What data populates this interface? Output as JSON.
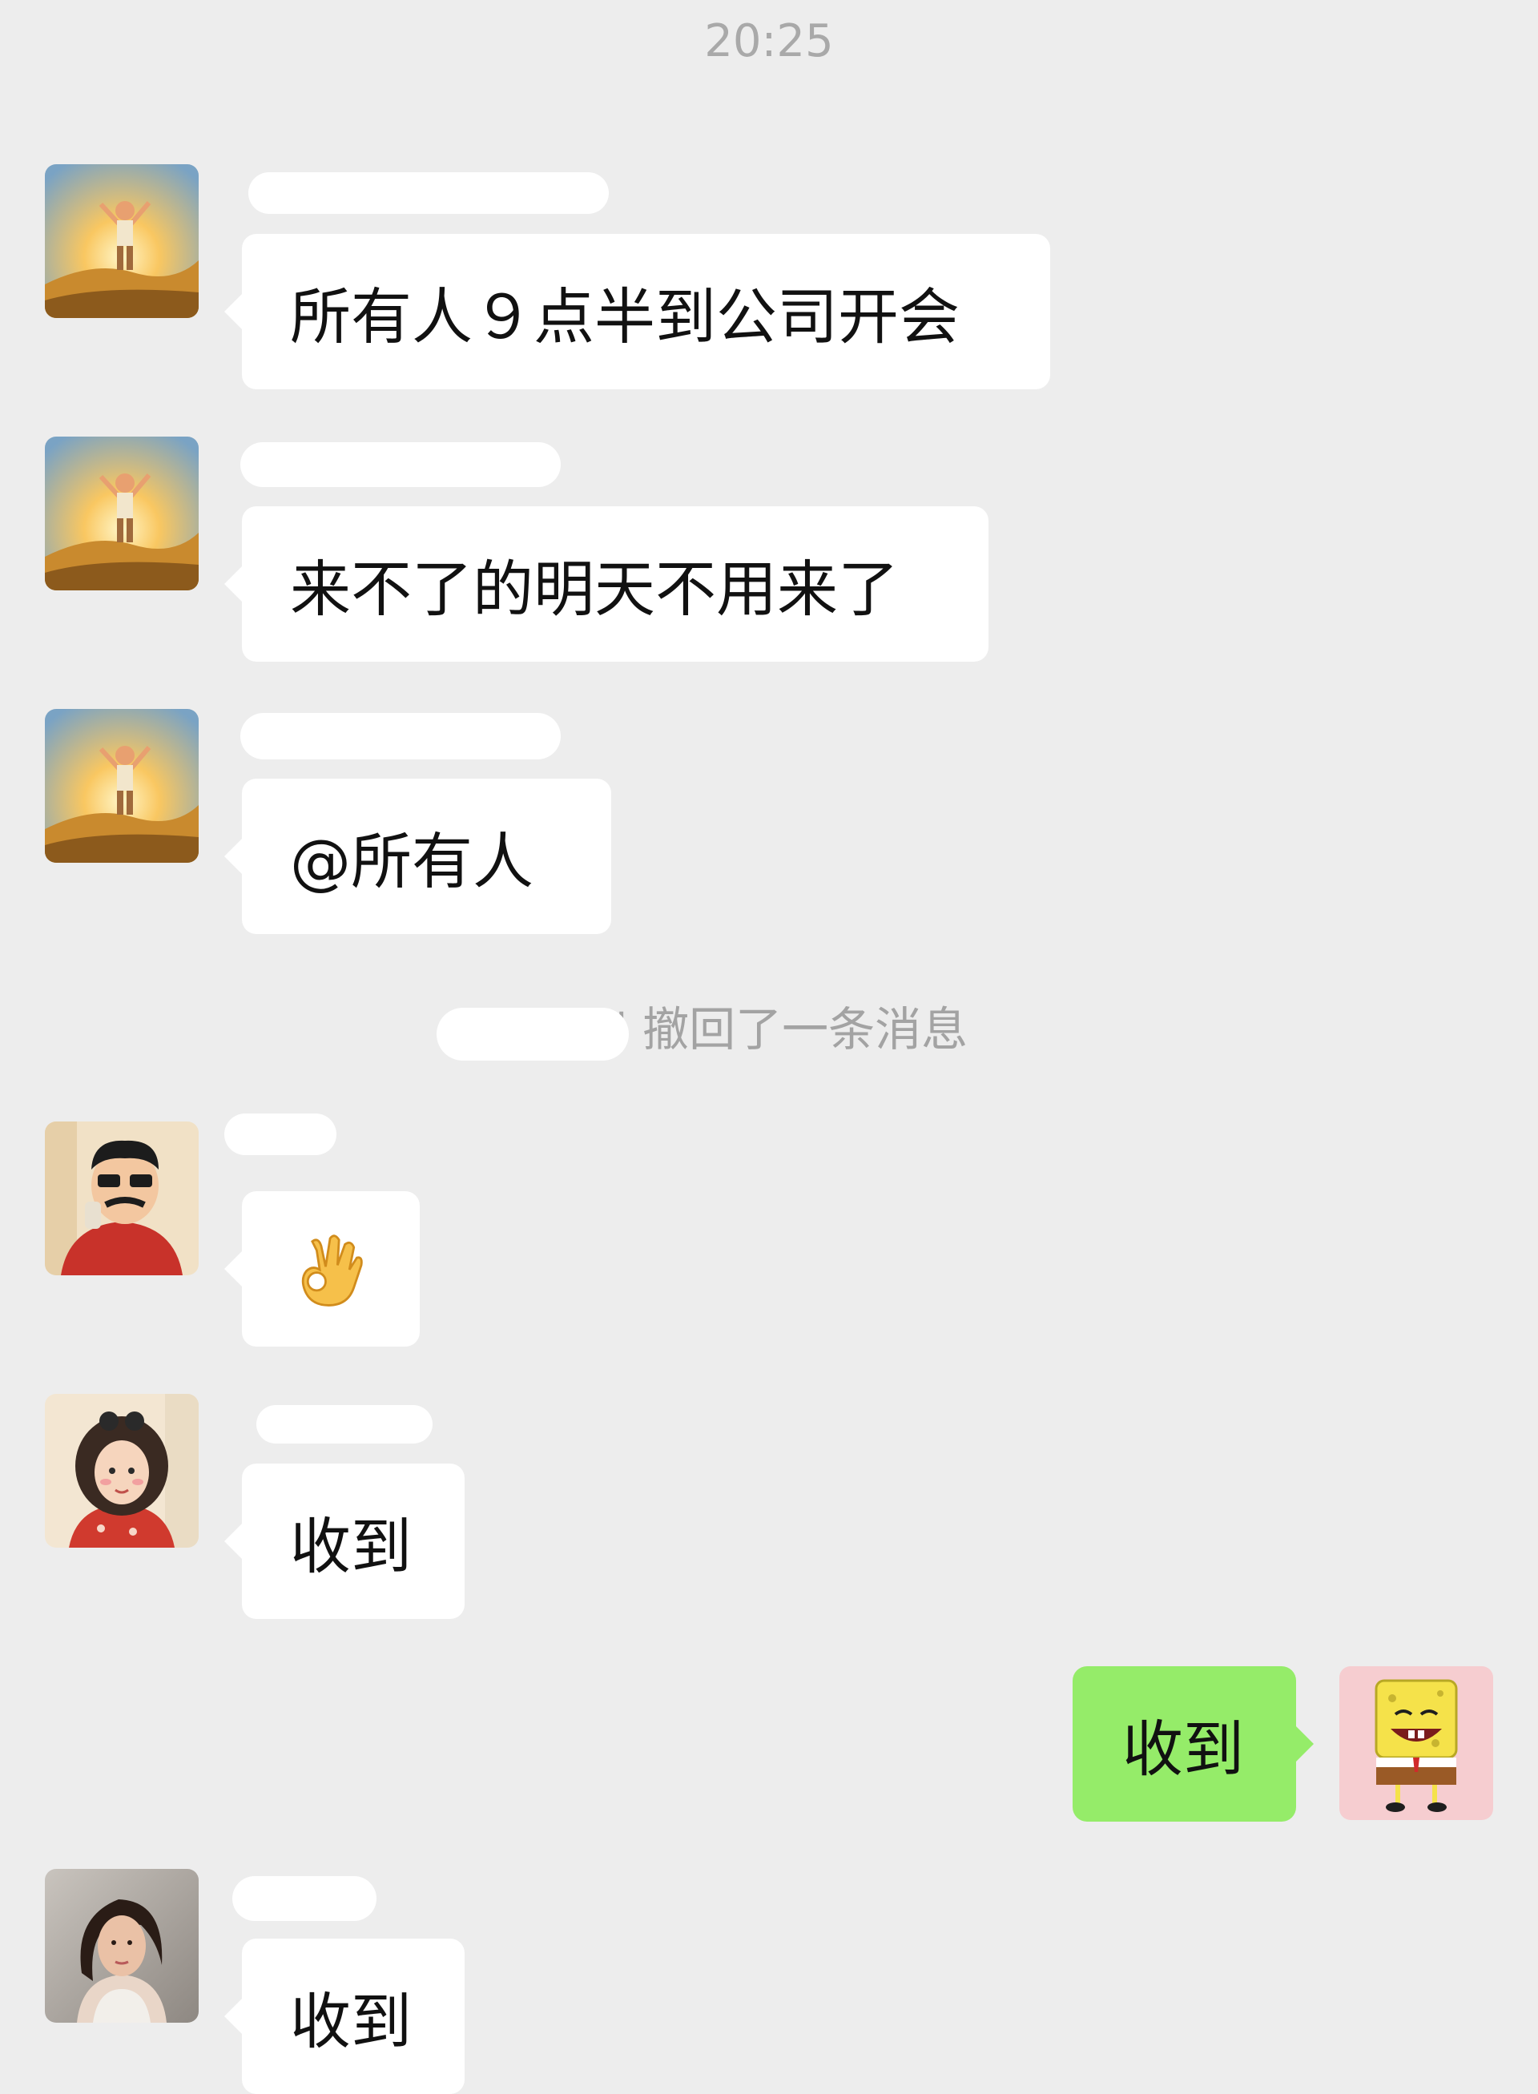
{
  "chat": {
    "timestamp": "20:25",
    "recall_notice": "\"      \" 撤回了一条消息",
    "messages": [
      {
        "sender": "",
        "text": "所有人９点半到公司开会",
        "direction": "incoming",
        "avatar": "boy-sunrise-icon"
      },
      {
        "sender": "",
        "text": "来不了的明天不用来了",
        "direction": "incoming",
        "avatar": "boy-sunrise-icon"
      },
      {
        "sender": "",
        "text": "@所有人",
        "direction": "incoming",
        "avatar": "boy-sunrise-icon"
      },
      {
        "sender": "",
        "text": "",
        "direction": "incoming",
        "avatar": "cartoon-dad-icon",
        "emoji": "ok-hand-icon"
      },
      {
        "sender": "",
        "text": "收到",
        "direction": "incoming",
        "avatar": "cartoon-girl-icon"
      },
      {
        "sender": "",
        "text": "收到",
        "direction": "outgoing",
        "avatar": "spongebob-icon"
      },
      {
        "sender": "",
        "text": "收到",
        "direction": "incoming",
        "avatar": "photo-woman-icon"
      }
    ]
  },
  "colors": {
    "background": "#ededed",
    "incoming_bubble": "#ffffff",
    "outgoing_bubble": "#95ec69",
    "timestamp_text": "#a9a9a9"
  }
}
